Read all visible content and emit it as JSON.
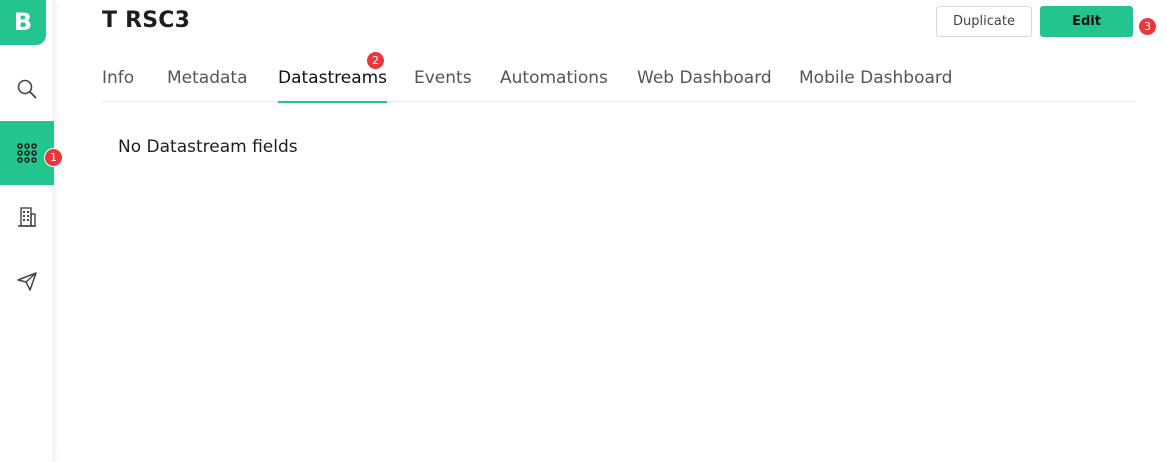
{
  "app": {
    "logo_letter": "B",
    "accent_color": "#23c48e",
    "badge_color": "#e8383d"
  },
  "sidebar": {
    "items": [
      {
        "icon": "search-icon"
      },
      {
        "icon": "grid-icon",
        "active": true,
        "badge": "1"
      },
      {
        "icon": "building-icon"
      },
      {
        "icon": "send-icon"
      }
    ]
  },
  "header": {
    "title": "T RSC3",
    "duplicate_label": "Duplicate",
    "edit_label": "Edit",
    "edit_badge": "3"
  },
  "tabs": [
    {
      "label": "Info"
    },
    {
      "label": "Metadata"
    },
    {
      "label": "Datastreams",
      "active": true,
      "badge": "2"
    },
    {
      "label": "Events"
    },
    {
      "label": "Automations"
    },
    {
      "label": "Web Dashboard"
    },
    {
      "label": "Mobile Dashboard"
    }
  ],
  "main": {
    "empty_message": "No Datastream fields"
  }
}
